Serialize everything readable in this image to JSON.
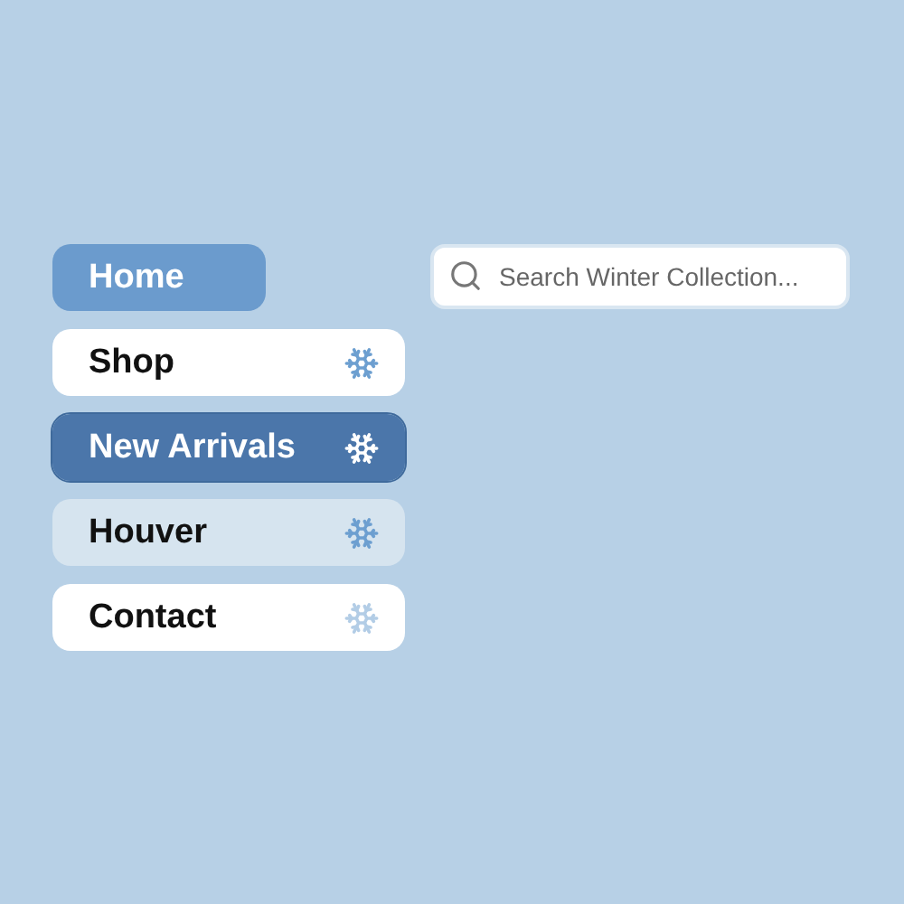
{
  "menu": [
    {
      "label": "Home",
      "kind": "primary",
      "icon": false,
      "selected": false
    },
    {
      "label": "Shop",
      "kind": "normal",
      "icon": true,
      "selected": false
    },
    {
      "label": "New Arrivals",
      "kind": "active",
      "icon": true,
      "selected": true
    },
    {
      "label": "Houver",
      "kind": "hover",
      "icon": true,
      "selected": false
    },
    {
      "label": "Contact",
      "kind": "muted",
      "icon": true,
      "selected": false
    }
  ],
  "search": {
    "placeholder": "Search Winter Collection..."
  }
}
